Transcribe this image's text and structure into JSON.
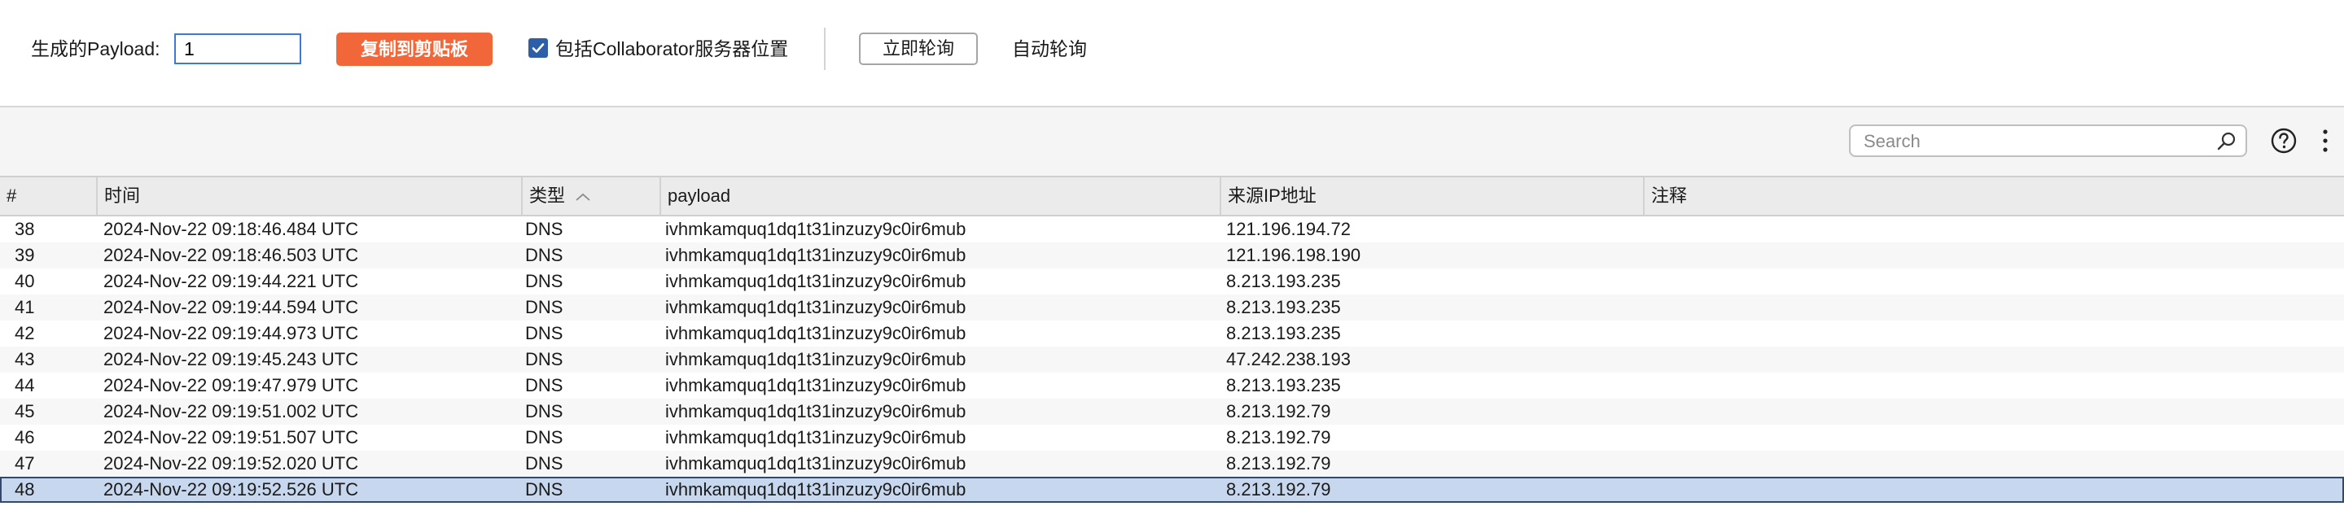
{
  "toolbar": {
    "payload_label": "生成的Payload:",
    "payload_value": "1",
    "copy_button": "复制到剪贴板",
    "include_location_checked": true,
    "include_location_label": "包括Collaborator服务器位置",
    "poll_now_button": "立即轮询",
    "auto_poll_label": "自动轮询"
  },
  "search": {
    "placeholder": "Search",
    "value": ""
  },
  "icons": {
    "search": "search-icon",
    "help": "help-icon",
    "more": "more-options-icon",
    "sort": "sort-ascending-icon",
    "checkbox": "checkbox-checked-icon"
  },
  "colors": {
    "accent_orange": "#f2673a",
    "checkbox_blue": "#2d5fa8",
    "selection": "#c7d7ee"
  },
  "table": {
    "columns": {
      "number": "#",
      "time": "时间",
      "type": "类型",
      "payload": "payload",
      "source_ip": "来源IP地址",
      "comment": "注释"
    },
    "sorted_column": "type",
    "rows": [
      {
        "number": "38",
        "time": "2024-Nov-22 09:18:46.484 UTC",
        "type": "DNS",
        "payload": "ivhmkamquq1dq1t31inzuzy9c0ir6mub",
        "source_ip": "121.196.194.72",
        "comment": ""
      },
      {
        "number": "39",
        "time": "2024-Nov-22 09:18:46.503 UTC",
        "type": "DNS",
        "payload": "ivhmkamquq1dq1t31inzuzy9c0ir6mub",
        "source_ip": "121.196.198.190",
        "comment": ""
      },
      {
        "number": "40",
        "time": "2024-Nov-22 09:19:44.221 UTC",
        "type": "DNS",
        "payload": "ivhmkamquq1dq1t31inzuzy9c0ir6mub",
        "source_ip": "8.213.193.235",
        "comment": ""
      },
      {
        "number": "41",
        "time": "2024-Nov-22 09:19:44.594 UTC",
        "type": "DNS",
        "payload": "ivhmkamquq1dq1t31inzuzy9c0ir6mub",
        "source_ip": "8.213.193.235",
        "comment": ""
      },
      {
        "number": "42",
        "time": "2024-Nov-22 09:19:44.973 UTC",
        "type": "DNS",
        "payload": "ivhmkamquq1dq1t31inzuzy9c0ir6mub",
        "source_ip": "8.213.193.235",
        "comment": ""
      },
      {
        "number": "43",
        "time": "2024-Nov-22 09:19:45.243 UTC",
        "type": "DNS",
        "payload": "ivhmkamquq1dq1t31inzuzy9c0ir6mub",
        "source_ip": "47.242.238.193",
        "comment": ""
      },
      {
        "number": "44",
        "time": "2024-Nov-22 09:19:47.979 UTC",
        "type": "DNS",
        "payload": "ivhmkamquq1dq1t31inzuzy9c0ir6mub",
        "source_ip": "8.213.193.235",
        "comment": ""
      },
      {
        "number": "45",
        "time": "2024-Nov-22 09:19:51.002 UTC",
        "type": "DNS",
        "payload": "ivhmkamquq1dq1t31inzuzy9c0ir6mub",
        "source_ip": "8.213.192.79",
        "comment": ""
      },
      {
        "number": "46",
        "time": "2024-Nov-22 09:19:51.507 UTC",
        "type": "DNS",
        "payload": "ivhmkamquq1dq1t31inzuzy9c0ir6mub",
        "source_ip": "8.213.192.79",
        "comment": ""
      },
      {
        "number": "47",
        "time": "2024-Nov-22 09:19:52.020 UTC",
        "type": "DNS",
        "payload": "ivhmkamquq1dq1t31inzuzy9c0ir6mub",
        "source_ip": "8.213.192.79",
        "comment": ""
      },
      {
        "number": "48",
        "time": "2024-Nov-22 09:19:52.526 UTC",
        "type": "DNS",
        "payload": "ivhmkamquq1dq1t31inzuzy9c0ir6mub",
        "source_ip": "8.213.192.79",
        "comment": "",
        "selected": true
      }
    ]
  }
}
